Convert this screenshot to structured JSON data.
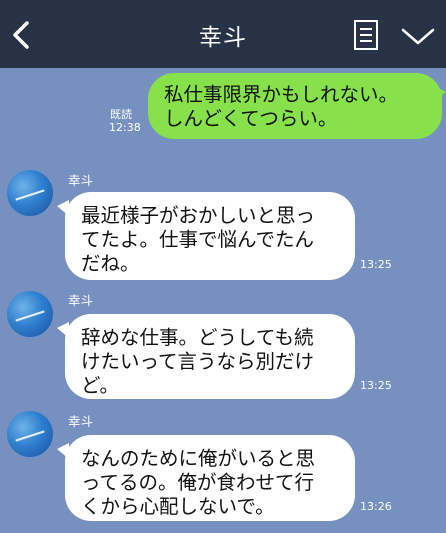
{
  "header": {
    "title": "幸斗",
    "back_icon": "chevron-left-icon",
    "notes_icon": "notes-icon",
    "menu_icon": "chevron-down-icon"
  },
  "colors": {
    "header_bg": "#273246",
    "chat_bg": "#7690c0",
    "outgoing_bubble": "#86e14a",
    "incoming_bubble": "#ffffff"
  },
  "messages": [
    {
      "direction": "outgoing",
      "lines": [
        "私仕事限界かもしれない。",
        "しんどくてつらい。"
      ],
      "read_label": "既読",
      "time": "12:38"
    },
    {
      "direction": "incoming",
      "sender": "幸斗",
      "lines": [
        "最近様子がおかしいと思っ",
        "てたよ。仕事で悩んでたん",
        "だね。"
      ],
      "time": "13:25"
    },
    {
      "direction": "incoming",
      "sender": "幸斗",
      "lines": [
        "辞めな仕事。どうしても続",
        "けたいって言うなら別だけ",
        "ど。"
      ],
      "time": "13:25"
    },
    {
      "direction": "incoming",
      "sender": "幸斗",
      "lines": [
        "なんのために俺がいると思",
        "ってるの。俺が食わせて行",
        "くから心配しないで。"
      ],
      "time": "13:26"
    }
  ]
}
